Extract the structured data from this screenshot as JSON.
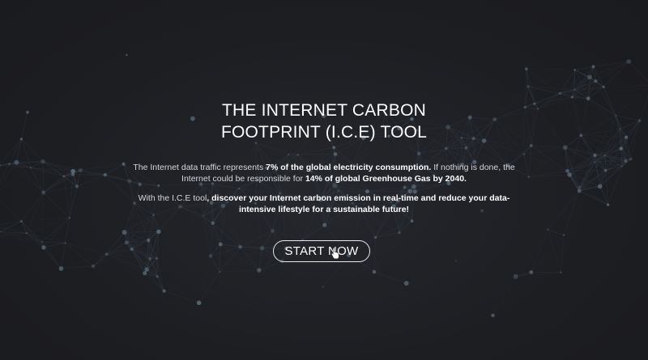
{
  "hero": {
    "title_line1": "THE INTERNET CARBON",
    "title_line2": "FOOTPRINT (I.C.E) TOOL",
    "para1": {
      "a": "The Internet data traffic represents ",
      "b": "7% of the global electricity consumption.",
      "c": "  If nothing is done, the Internet could be responsible for ",
      "d": "14% of global Greenhouse Gas by 2040."
    },
    "para2": {
      "a": "With the I.C.E tool",
      "b": ", discover your Internet carbon emission in real-time and reduce your data-intensive lifestyle for a sustainable future!"
    },
    "cta_label": "START NOW"
  },
  "colors": {
    "background": "#1e1f23",
    "node": "#5a6e7c",
    "line": "#3b4650"
  },
  "icons": {
    "cursor": "hand-pointer-icon"
  }
}
